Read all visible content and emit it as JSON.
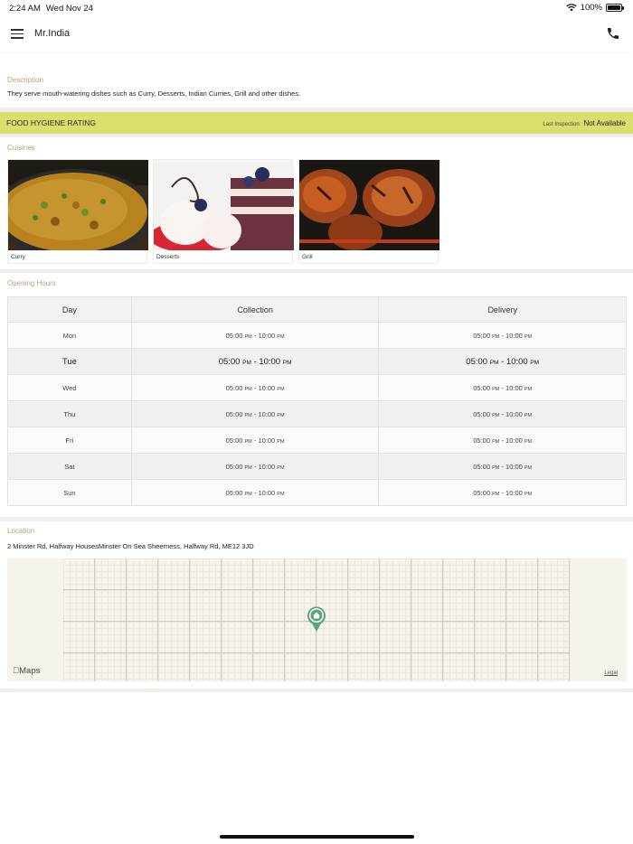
{
  "status": {
    "time": "2:24 AM",
    "date": "Wed Nov 24",
    "battery": "100%"
  },
  "header": {
    "title": "Mr.India"
  },
  "description": {
    "label": "Description",
    "text": "They serve mouth-watering dishes such as Curry, Desserts, Indian Curries, Grill and other dishes."
  },
  "hygiene": {
    "title": "FOOD HYGIENE RATING",
    "inspection_label": "Last Inspection:",
    "inspection_value": "Not Available"
  },
  "cuisines": {
    "label": "Cuisines",
    "items": [
      {
        "label": "Curry"
      },
      {
        "label": "Desserts"
      },
      {
        "label": "Grill"
      }
    ]
  },
  "hours": {
    "label": "Opening Hours",
    "headers": {
      "day": "Day",
      "collection": "Collection",
      "delivery": "Delivery"
    },
    "ampm": "PM",
    "open": "05:00",
    "close": "10:00",
    "rows": [
      {
        "day": "Mon"
      },
      {
        "day": "Tue"
      },
      {
        "day": "Wed"
      },
      {
        "day": "Thu"
      },
      {
        "day": "Fri"
      },
      {
        "day": "Sat"
      },
      {
        "day": "Sun"
      }
    ]
  },
  "location": {
    "label": "Location",
    "address": "2  Minster Rd, Halfway HousesMinster On Sea Sheerness, Halfway Rd, ME12 3JD",
    "maps_label": "Maps",
    "legal": "Legal"
  },
  "colors": {
    "accent": "#dade6d",
    "label": "#b9a27a",
    "pin": "#5aa57a"
  }
}
